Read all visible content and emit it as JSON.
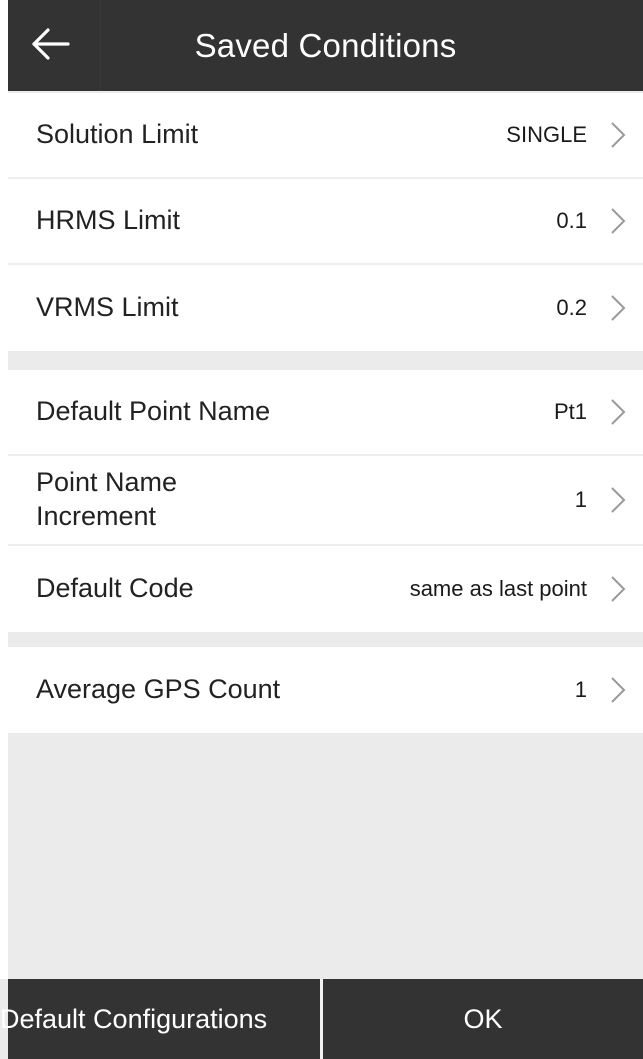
{
  "header": {
    "title": "Saved Conditions",
    "back_icon": "arrow-left-icon"
  },
  "groups": [
    {
      "rows": [
        {
          "label": "Solution Limit",
          "value": "SINGLE"
        },
        {
          "label": "HRMS Limit",
          "value": "0.1"
        },
        {
          "label": "VRMS Limit",
          "value": "0.2"
        }
      ]
    },
    {
      "rows": [
        {
          "label": "Default Point Name",
          "value": "Pt1"
        },
        {
          "label": "Point Name\nIncrement",
          "value": "1"
        },
        {
          "label": "Default Code",
          "value": "same as last point"
        }
      ]
    },
    {
      "rows": [
        {
          "label": "Average GPS Count",
          "value": "1"
        }
      ]
    }
  ],
  "footer": {
    "default_label": "Default Configurations",
    "ok_label": "OK"
  },
  "colors": {
    "bar": "#333333",
    "background": "#ebebeb",
    "row": "#ffffff",
    "chevron": "#9a9a9a"
  }
}
